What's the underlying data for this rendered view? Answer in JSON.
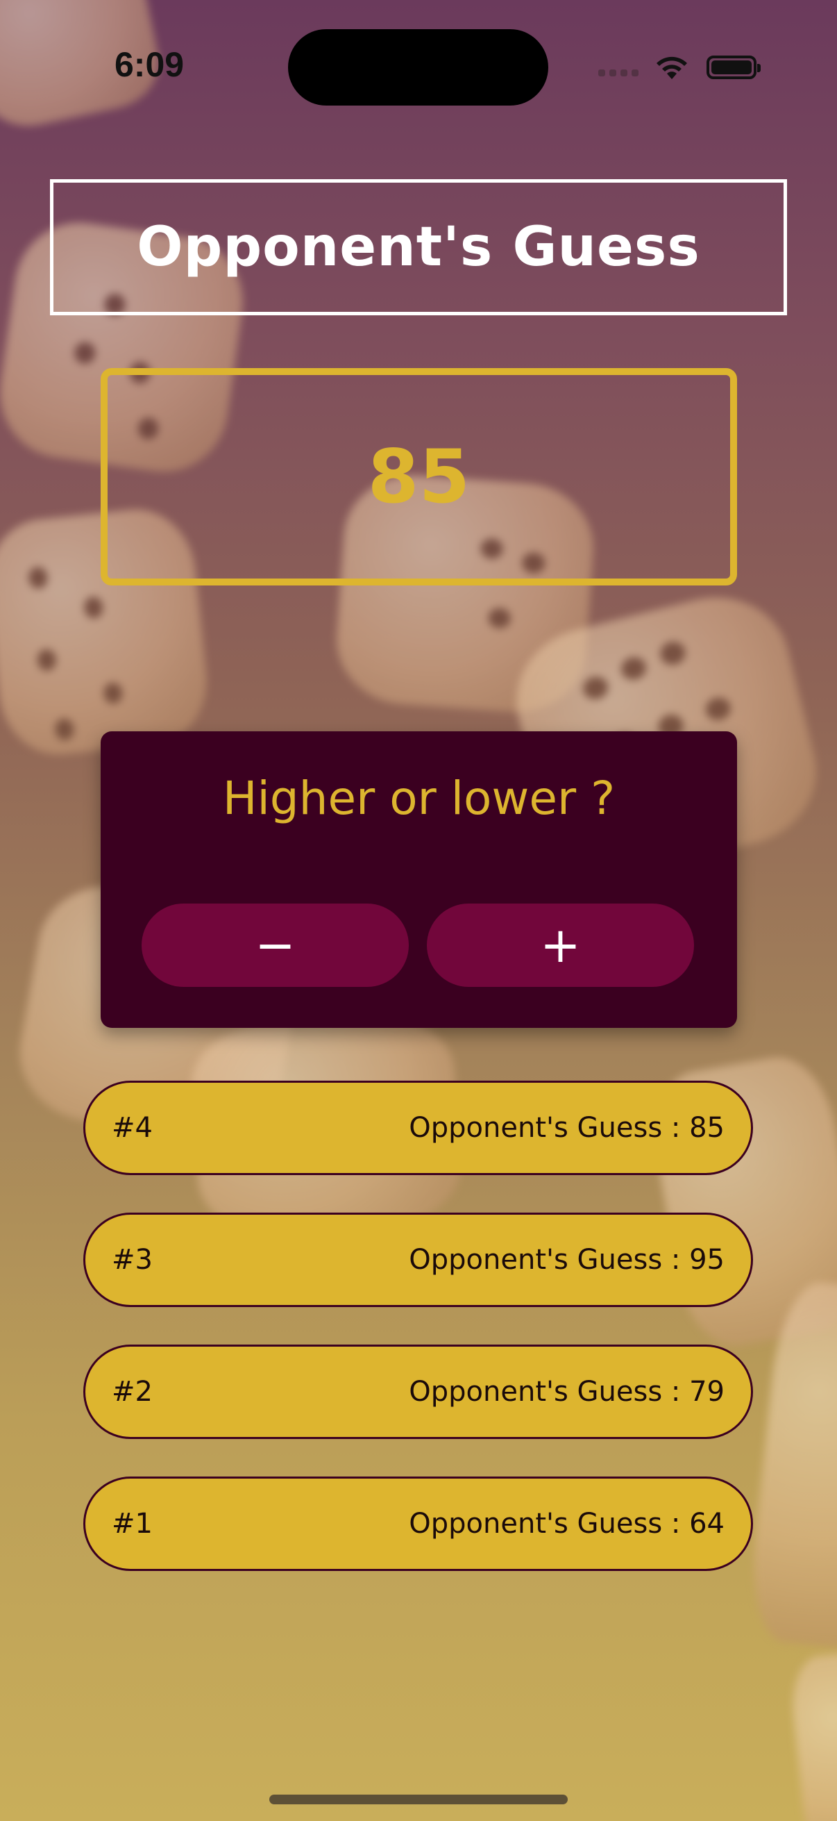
{
  "status_bar": {
    "time": "6:09"
  },
  "title": "Opponent's Guess",
  "current_guess": "85",
  "prompt": "Higher or lower ?",
  "buttons": {
    "lower_label": "−",
    "higher_label": "+"
  },
  "guess_log": [
    {
      "round": "#4",
      "text": "Opponent's Guess : 85"
    },
    {
      "round": "#3",
      "text": "Opponent's Guess : 95"
    },
    {
      "round": "#2",
      "text": "Opponent's Guess : 79"
    },
    {
      "round": "#1",
      "text": "Opponent's Guess : 64"
    }
  ],
  "colors": {
    "accent": "#ddb52f",
    "card": "#3b0020",
    "button": "#72063b"
  },
  "icons": [
    "wifi-icon",
    "battery-icon",
    "signal-icon",
    "minus-icon",
    "plus-icon"
  ]
}
